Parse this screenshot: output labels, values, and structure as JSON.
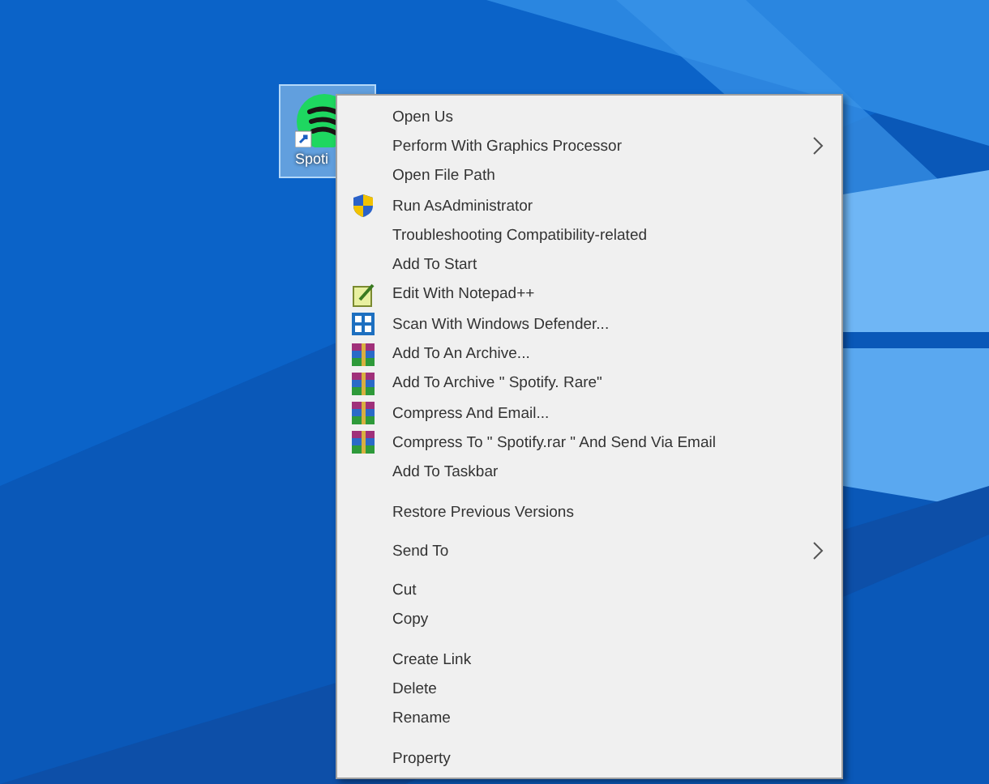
{
  "desktop_icon": {
    "label": "Spoti",
    "selected": true
  },
  "context_menu": {
    "groups": [
      {
        "items": [
          {
            "label": "Open Us",
            "kind": "plain",
            "submenu": false
          },
          {
            "label": "Perform With Graphics Processor",
            "kind": "plain",
            "submenu": true
          },
          {
            "label": "Open File Path",
            "kind": "plain",
            "submenu": false
          },
          {
            "label": "Run AsAdministrator",
            "kind": "shield",
            "submenu": false
          },
          {
            "label": "Troubleshooting Compatibility-related",
            "kind": "plain",
            "submenu": false
          },
          {
            "label": "Add To Start",
            "kind": "plain",
            "submenu": false
          },
          {
            "label": "Edit With Notepad++",
            "kind": "notepad",
            "submenu": false
          },
          {
            "label": "Scan With Windows Defender...",
            "kind": "defender",
            "submenu": false
          },
          {
            "label": "Add To An Archive...",
            "kind": "archive",
            "submenu": false
          },
          {
            "label": "Add To Archive \" Spotify. Rare\"",
            "kind": "archive",
            "submenu": false
          },
          {
            "label": "Compress And Email...",
            "kind": "archive",
            "submenu": false
          },
          {
            "label": "Compress To \" Spotify.rar \" And Send Via Email",
            "kind": "archive",
            "submenu": false
          },
          {
            "label": "Add To Taskbar",
            "kind": "plain",
            "submenu": false
          }
        ]
      },
      {
        "items": [
          {
            "label": "Restore Previous Versions",
            "kind": "plain",
            "submenu": false
          }
        ]
      },
      {
        "items": [
          {
            "label": "Send To",
            "kind": "plain",
            "submenu": true
          }
        ]
      },
      {
        "items": [
          {
            "label": "Cut",
            "kind": "plain",
            "submenu": false
          },
          {
            "label": "Copy",
            "kind": "plain",
            "submenu": false
          }
        ]
      },
      {
        "items": [
          {
            "label": "Create Link",
            "kind": "plain",
            "submenu": false
          },
          {
            "label": "Delete",
            "kind": "plain",
            "submenu": false
          },
          {
            "label": "Rename",
            "kind": "plain",
            "submenu": false
          }
        ]
      },
      {
        "items": [
          {
            "label": "Property",
            "kind": "plain",
            "submenu": false
          }
        ]
      }
    ]
  }
}
